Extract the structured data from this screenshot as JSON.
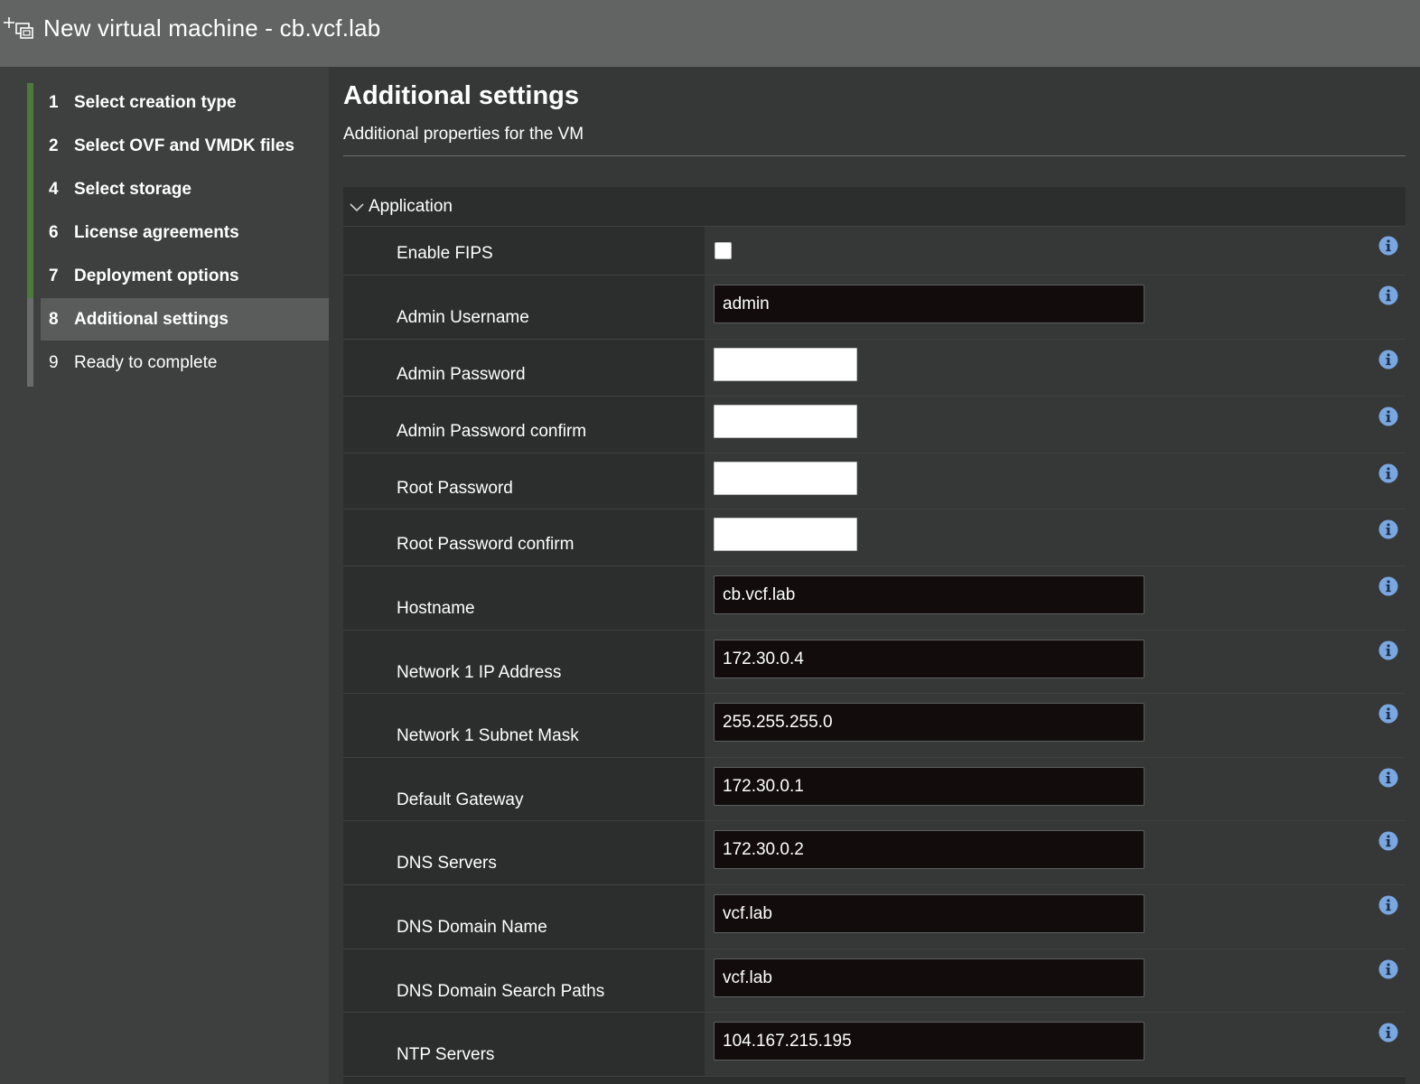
{
  "window": {
    "title": "New virtual machine - cb.vcf.lab",
    "icon": "add-vm-icon"
  },
  "sidebar": {
    "steps": [
      {
        "number": "1",
        "label": "Select creation type",
        "state": "completed"
      },
      {
        "number": "2",
        "label": "Select OVF and VMDK files",
        "state": "completed"
      },
      {
        "number": "4",
        "label": "Select storage",
        "state": "completed"
      },
      {
        "number": "6",
        "label": "License agreements",
        "state": "completed"
      },
      {
        "number": "7",
        "label": "Deployment options",
        "state": "completed"
      },
      {
        "number": "8",
        "label": "Additional settings",
        "state": "active"
      },
      {
        "number": "9",
        "label": "Ready to complete",
        "state": "pending"
      }
    ]
  },
  "main": {
    "title": "Additional settings",
    "subtitle": "Additional properties for the VM",
    "section": {
      "label": "Application",
      "expanded": true,
      "icon": "chevron-down-icon"
    },
    "fields": [
      {
        "label": "Enable FIPS",
        "type": "checkbox",
        "checked": false,
        "info_icon": "info-icon"
      },
      {
        "label": "Admin Username",
        "type": "text",
        "value": "admin",
        "info_icon": "info-icon"
      },
      {
        "label": "Admin Password",
        "type": "password",
        "value": "",
        "info_icon": "info-icon"
      },
      {
        "label": "Admin Password confirm",
        "type": "password",
        "value": "",
        "info_icon": "info-icon"
      },
      {
        "label": "Root Password",
        "type": "password",
        "value": "",
        "info_icon": "info-icon"
      },
      {
        "label": "Root Password confirm",
        "type": "password",
        "value": "",
        "info_icon": "info-icon"
      },
      {
        "label": "Hostname",
        "type": "text",
        "value": "cb.vcf.lab",
        "info_icon": "info-icon"
      },
      {
        "label": "Network 1 IP Address",
        "type": "text",
        "value": "172.30.0.4",
        "info_icon": "info-icon"
      },
      {
        "label": "Network 1 Subnet Mask",
        "type": "text",
        "value": "255.255.255.0",
        "info_icon": "info-icon"
      },
      {
        "label": "Default Gateway",
        "type": "text",
        "value": "172.30.0.1",
        "info_icon": "info-icon"
      },
      {
        "label": "DNS Servers",
        "type": "text",
        "value": "172.30.0.2",
        "info_icon": "info-icon"
      },
      {
        "label": "DNS Domain Name",
        "type": "text",
        "value": "vcf.lab",
        "info_icon": "info-icon"
      },
      {
        "label": "DNS Domain Search Paths",
        "type": "text",
        "value": "vcf.lab",
        "info_icon": "info-icon"
      },
      {
        "label": "NTP Servers",
        "type": "text",
        "value": "104.167.215.195",
        "info_icon": "info-icon"
      }
    ]
  },
  "colors": {
    "titlebar": "#626464",
    "sidebar": "#3e4040",
    "completed_rail": "#4b7a3c",
    "info_icon": "#7aa7e0"
  }
}
